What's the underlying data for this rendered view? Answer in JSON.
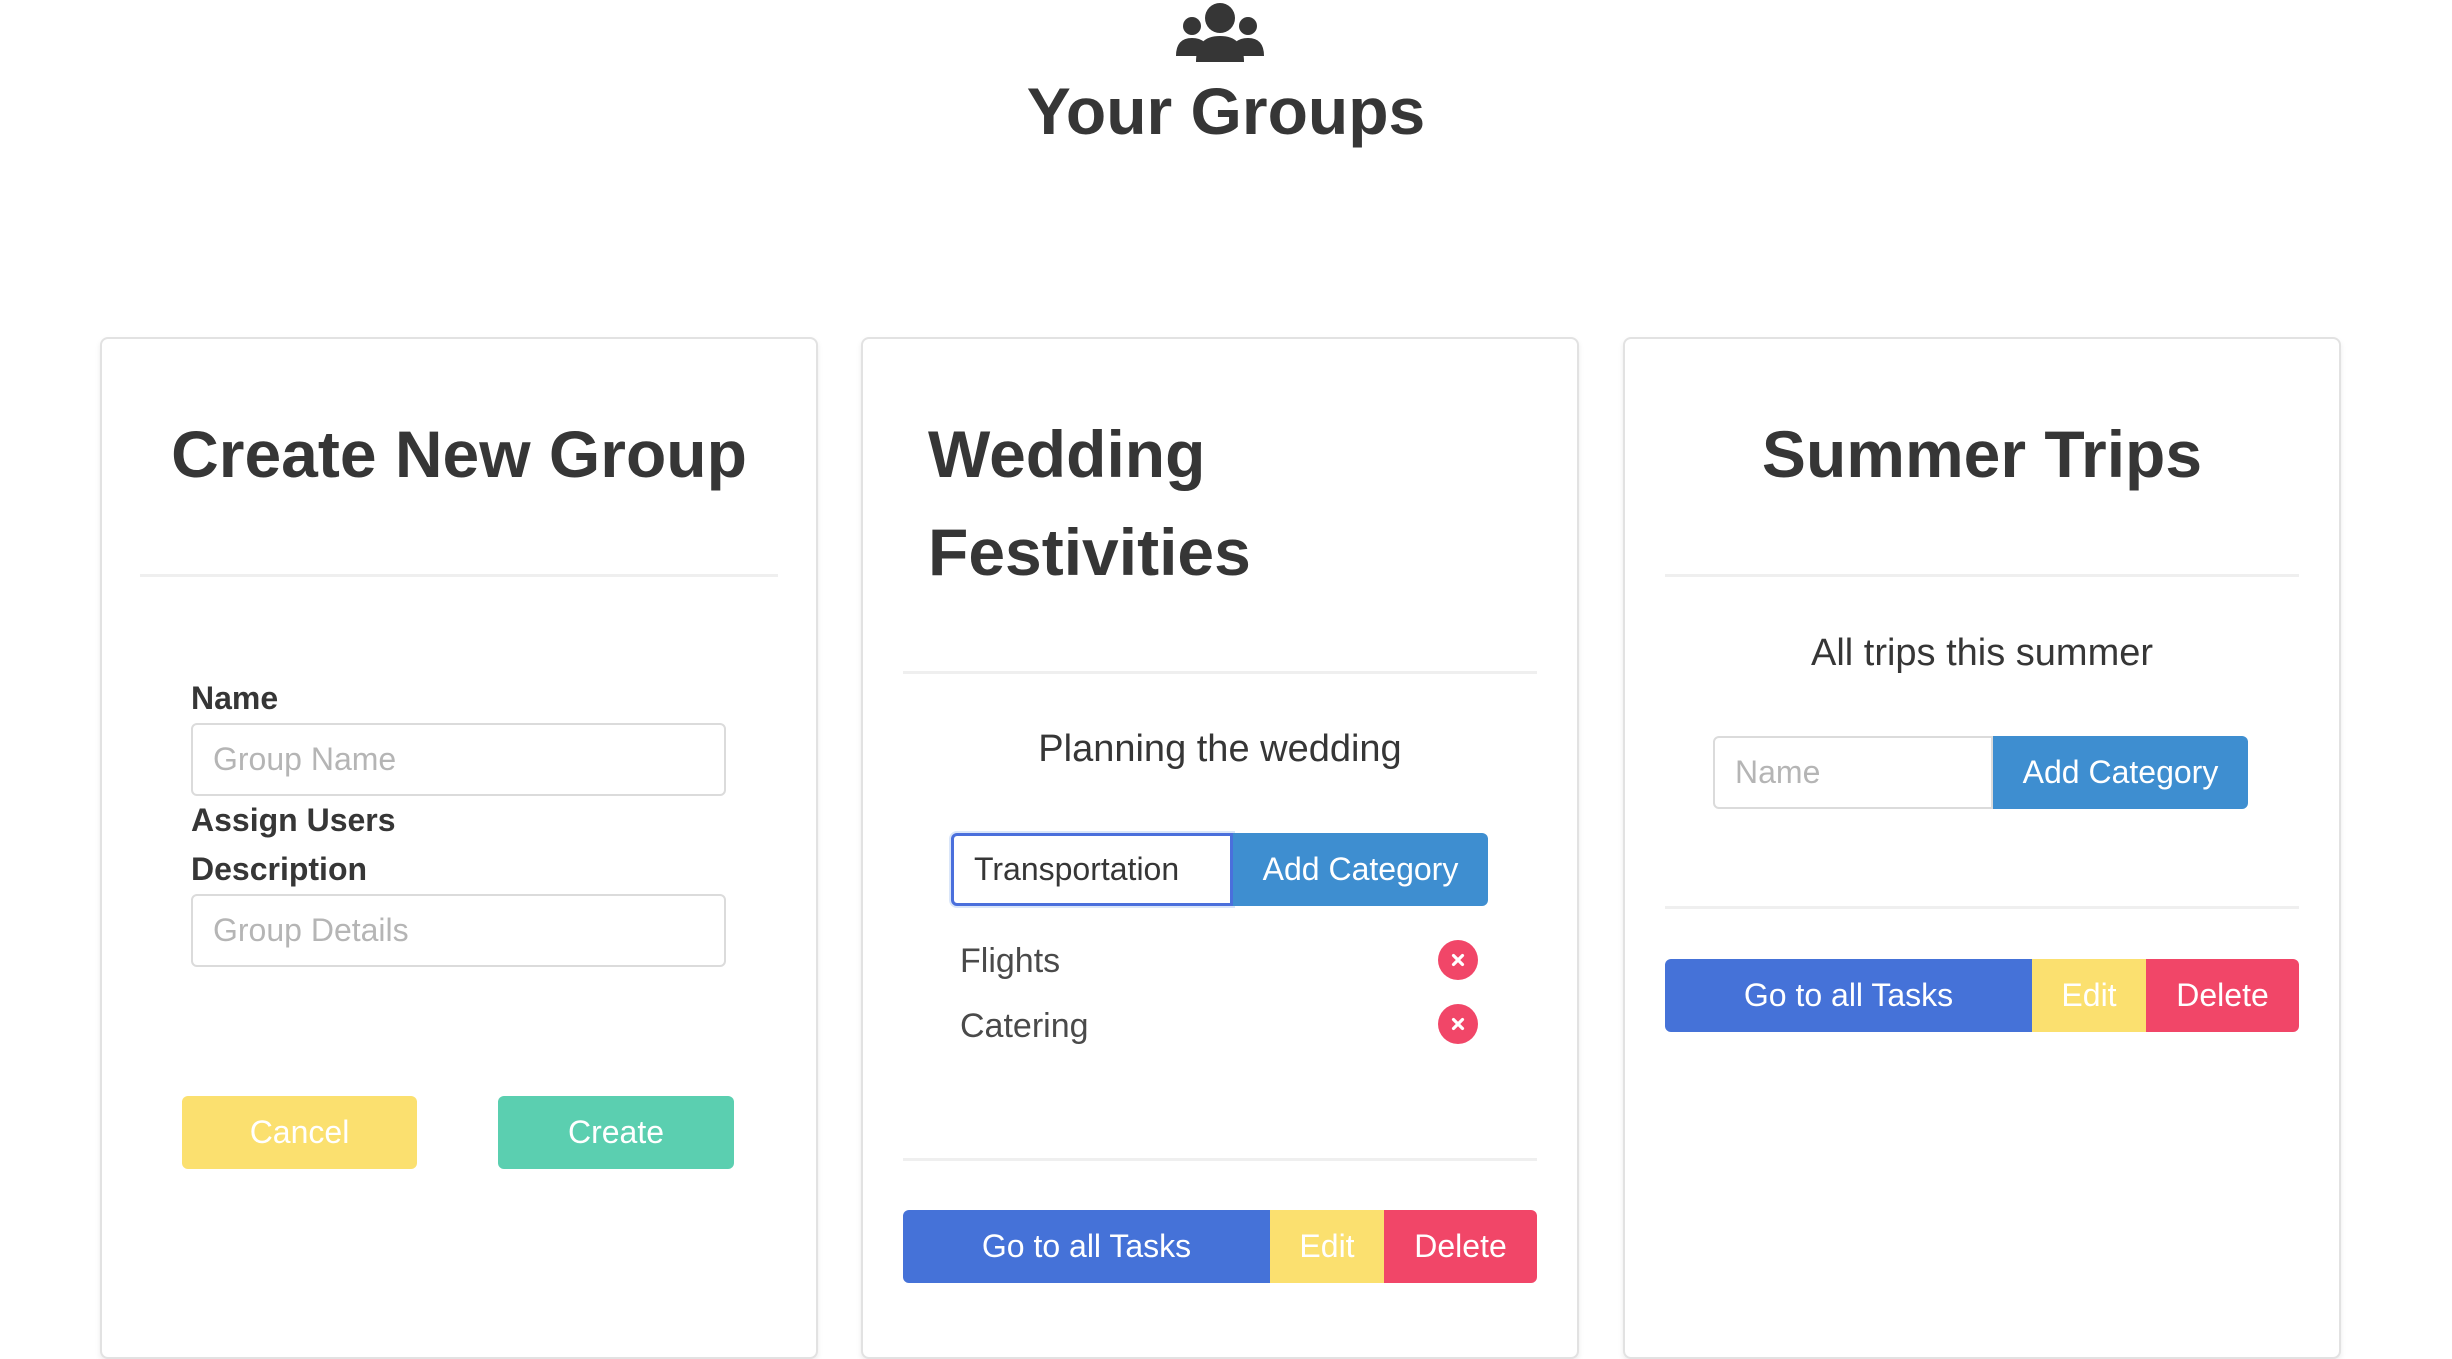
{
  "header": {
    "icon": "users-icon",
    "title": "Your Groups"
  },
  "create_card": {
    "title": "Create New Group",
    "name_label": "Name",
    "name_placeholder": "Group Name",
    "assign_users_label": "Assign Users",
    "description_label": "Description",
    "description_placeholder": "Group Details",
    "cancel_label": "Cancel",
    "create_label": "Create"
  },
  "groups": [
    {
      "title_line1": "Wedding",
      "title_line2": "Festivities",
      "description": "Planning the wedding",
      "category_input_value": "Transportation",
      "add_category_label": "Add Category",
      "categories": [
        "Flights",
        "Catering"
      ],
      "go_to_tasks_label": "Go to all Tasks",
      "edit_label": "Edit",
      "delete_label": "Delete"
    },
    {
      "title": "Summer Trips",
      "description": "All trips this summer",
      "category_input_placeholder": "Name",
      "add_category_label": "Add Category",
      "go_to_tasks_label": "Go to all Tasks",
      "edit_label": "Edit",
      "delete_label": "Delete"
    }
  ],
  "colors": {
    "text": "#363636",
    "info": "#3e8ed0",
    "warning": "#fbe06f",
    "success": "#5bcfb0",
    "link": "#4572d8",
    "danger": "#f14668"
  }
}
